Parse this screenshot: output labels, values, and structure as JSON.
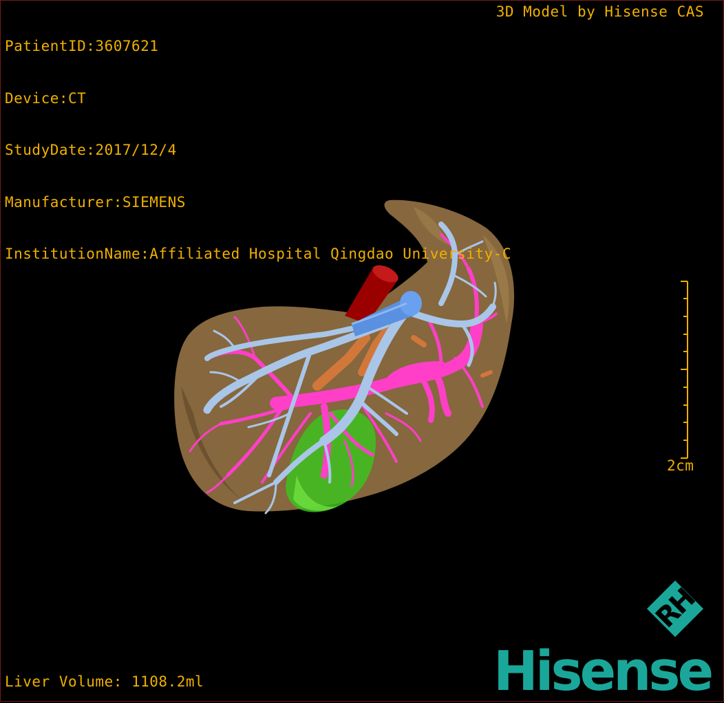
{
  "overlay": {
    "patient_id": "PatientID:3607621",
    "device": "Device:CT",
    "study_date": "StudyDate:2017/12/4",
    "manufacturer": "Manufacturer:SIEMENS",
    "institution": "InstitutionName:Affiliated Hospital Qingdao University-C",
    "model_credit": "3D Model by Hisense CAS",
    "liver_volume": "Liver Volume: 1108.2ml"
  },
  "scale_bar": {
    "label": "2cm",
    "color": "#f0b000"
  },
  "branding": {
    "badge_text": "RH",
    "logo_text": "Hisense",
    "color": "#1aa79a"
  },
  "model_colors": {
    "liver": "#8a6a40",
    "portal_vein": "#ff3fc8",
    "hepatic_vein": "#a9c6e8",
    "vena_cava": "#5a90e0",
    "aorta": "#9a0000",
    "gallbladder": "#3ec21f",
    "biliary": "#e07a3a"
  }
}
